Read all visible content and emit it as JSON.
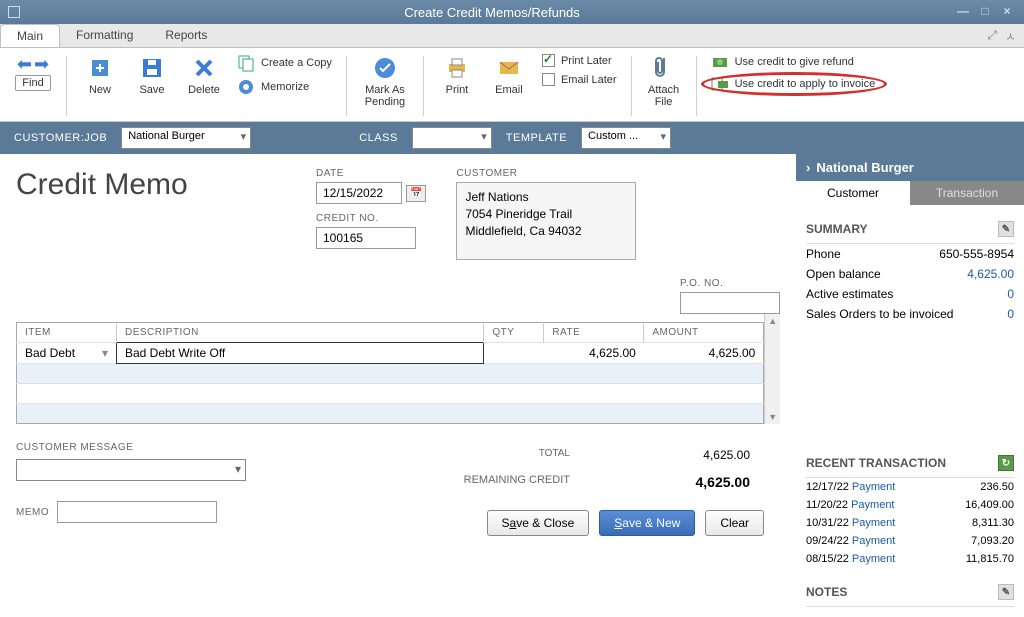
{
  "window": {
    "title": "Create Credit Memos/Refunds"
  },
  "tabs": {
    "main": "Main",
    "formatting": "Formatting",
    "reports": "Reports"
  },
  "ribbon": {
    "find": "Find",
    "new": "New",
    "save": "Save",
    "delete": "Delete",
    "create_copy": "Create a Copy",
    "memorize": "Memorize",
    "mark_pending": "Mark As Pending",
    "print": "Print",
    "email": "Email",
    "print_later": "Print Later",
    "email_later": "Email Later",
    "attach": "Attach File",
    "credit_refund": "Use credit to give refund",
    "credit_invoice": "Use credit to apply to invoice"
  },
  "header": {
    "customer_job_lbl": "CUSTOMER:JOB",
    "customer_job": "National Burger",
    "class_lbl": "CLASS",
    "class_val": "",
    "template_lbl": "TEMPLATE",
    "template": "Custom ..."
  },
  "form": {
    "title": "Credit Memo",
    "date_lbl": "DATE",
    "date": "12/15/2022",
    "credit_no_lbl": "CREDIT NO.",
    "credit_no": "100165",
    "customer_lbl": "CUSTOMER",
    "customer_name": "Jeff Nations",
    "customer_addr1": "7054 Pineridge Trail",
    "customer_addr2": "Middlefield, Ca 94032",
    "po_lbl": "P.O. NO.",
    "po_no": ""
  },
  "table": {
    "cols": {
      "item": "ITEM",
      "desc": "DESCRIPTION",
      "qty": "QTY",
      "rate": "RATE",
      "amount": "AMOUNT"
    },
    "rows": [
      {
        "item": "Bad Debt",
        "desc": "Bad Debt Write Off",
        "qty": "",
        "rate": "4,625.00",
        "amount": "4,625.00"
      }
    ]
  },
  "totals": {
    "total_lbl": "TOTAL",
    "total": "4,625.00",
    "remaining_lbl": "REMAINING CREDIT",
    "remaining": "4,625.00"
  },
  "bottom": {
    "msg_lbl": "CUSTOMER MESSAGE",
    "msg": "",
    "memo_lbl": "MEMO",
    "memo": "",
    "save_close": "Save & Close",
    "save_new": "Save & New",
    "clear": "Clear"
  },
  "side": {
    "title": "National Burger",
    "tab_customer": "Customer",
    "tab_transaction": "Transaction",
    "summary_lbl": "SUMMARY",
    "phone_lbl": "Phone",
    "phone": "650-555-8954",
    "open_lbl": "Open balance",
    "open": "4,625.00",
    "active_lbl": "Active estimates",
    "active": "0",
    "sales_lbl": "Sales Orders to be invoiced",
    "sales": "0",
    "recent_lbl": "RECENT TRANSACTION",
    "trans": [
      {
        "date": "12/17/22",
        "type": "Payment",
        "amt": "236.50"
      },
      {
        "date": "11/20/22",
        "type": "Payment",
        "amt": "16,409.00"
      },
      {
        "date": "10/31/22",
        "type": "Payment",
        "amt": "8,311.30"
      },
      {
        "date": "09/24/22",
        "type": "Payment",
        "amt": "7,093.20"
      },
      {
        "date": "08/15/22",
        "type": "Payment",
        "amt": "11,815.70"
      }
    ],
    "notes_lbl": "NOTES"
  }
}
